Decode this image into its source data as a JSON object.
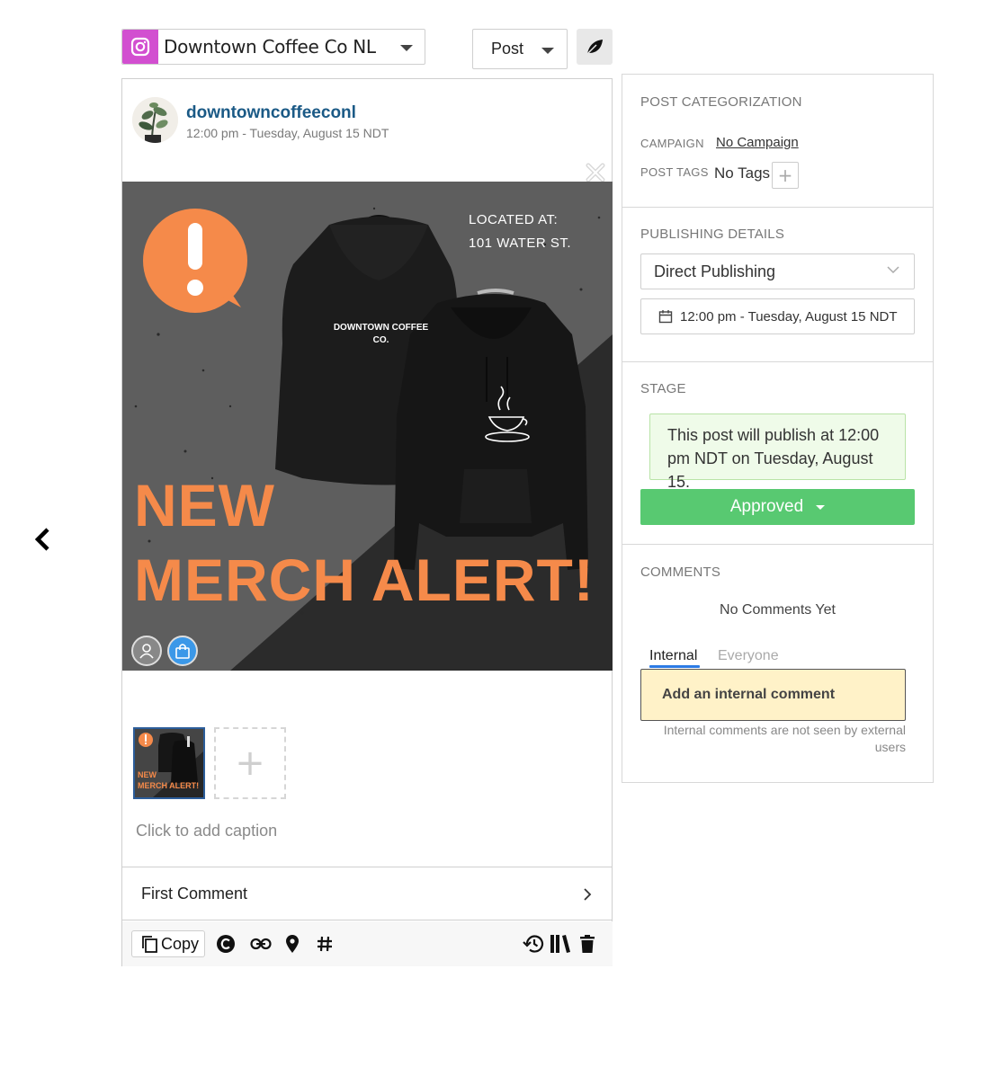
{
  "header": {
    "account_name": "Downtown Coffee Co NL",
    "post_type": "Post"
  },
  "post": {
    "username": "downtowncoffeeconl",
    "time": "12:00 pm - Tuesday, August 15 NDT",
    "media": {
      "located_line1": "LOCATED AT:",
      "located_line2": "101 WATER ST.",
      "hoodie_text_line1": "DOWNTOWN COFFEE",
      "hoodie_text_line2": "CO.",
      "headline_line1": "NEW",
      "headline_line2": "MERCH ALERT!"
    },
    "thumbnail": {
      "line1": "NEW",
      "line2": "MERCH ALERT!"
    },
    "caption_placeholder": "Click to add caption",
    "first_comment_label": "First Comment",
    "toolbar": {
      "copy_label": "Copy"
    }
  },
  "sidebar": {
    "categorization": {
      "title": "POST CATEGORIZATION",
      "campaign_label": "CAMPAIGN",
      "campaign_value": "No Campaign",
      "tags_label": "POST TAGS",
      "tags_value": "No Tags",
      "add_tag_symbol": "+"
    },
    "publishing": {
      "title": "PUBLISHING DETAILS",
      "method": "Direct Publishing",
      "datetime": "12:00 pm - Tuesday, August 15 NDT"
    },
    "stage": {
      "title": "STAGE",
      "note": "This post will publish at 12:00 pm NDT on Tuesday, August 15.",
      "status": "Approved"
    },
    "comments": {
      "title": "COMMENTS",
      "empty_text": "No Comments Yet",
      "tab_internal": "Internal",
      "tab_everyone": "Everyone",
      "input_placeholder": "Add an internal comment",
      "note": "Internal comments are not seen by external users"
    }
  },
  "colors": {
    "instagram": "#d24fd0",
    "username": "#1b5a86",
    "accent_orange": "#f58a4a",
    "approved": "#58c971",
    "stage_note_bg": "#effbe9",
    "comment_bg": "#fff2c8",
    "tab_underline": "#2c7be5"
  },
  "icons": [
    "instagram-icon",
    "leaf-icon",
    "back-arrow-icon",
    "close-icon",
    "user-tag-icon",
    "shopping-bag-icon",
    "chevron-right-icon",
    "copy-icon",
    "c-icon",
    "link-icon",
    "location-icon",
    "hashtag-icon",
    "history-icon",
    "library-icon",
    "trash-icon",
    "calendar-icon",
    "chevron-down-icon"
  ]
}
